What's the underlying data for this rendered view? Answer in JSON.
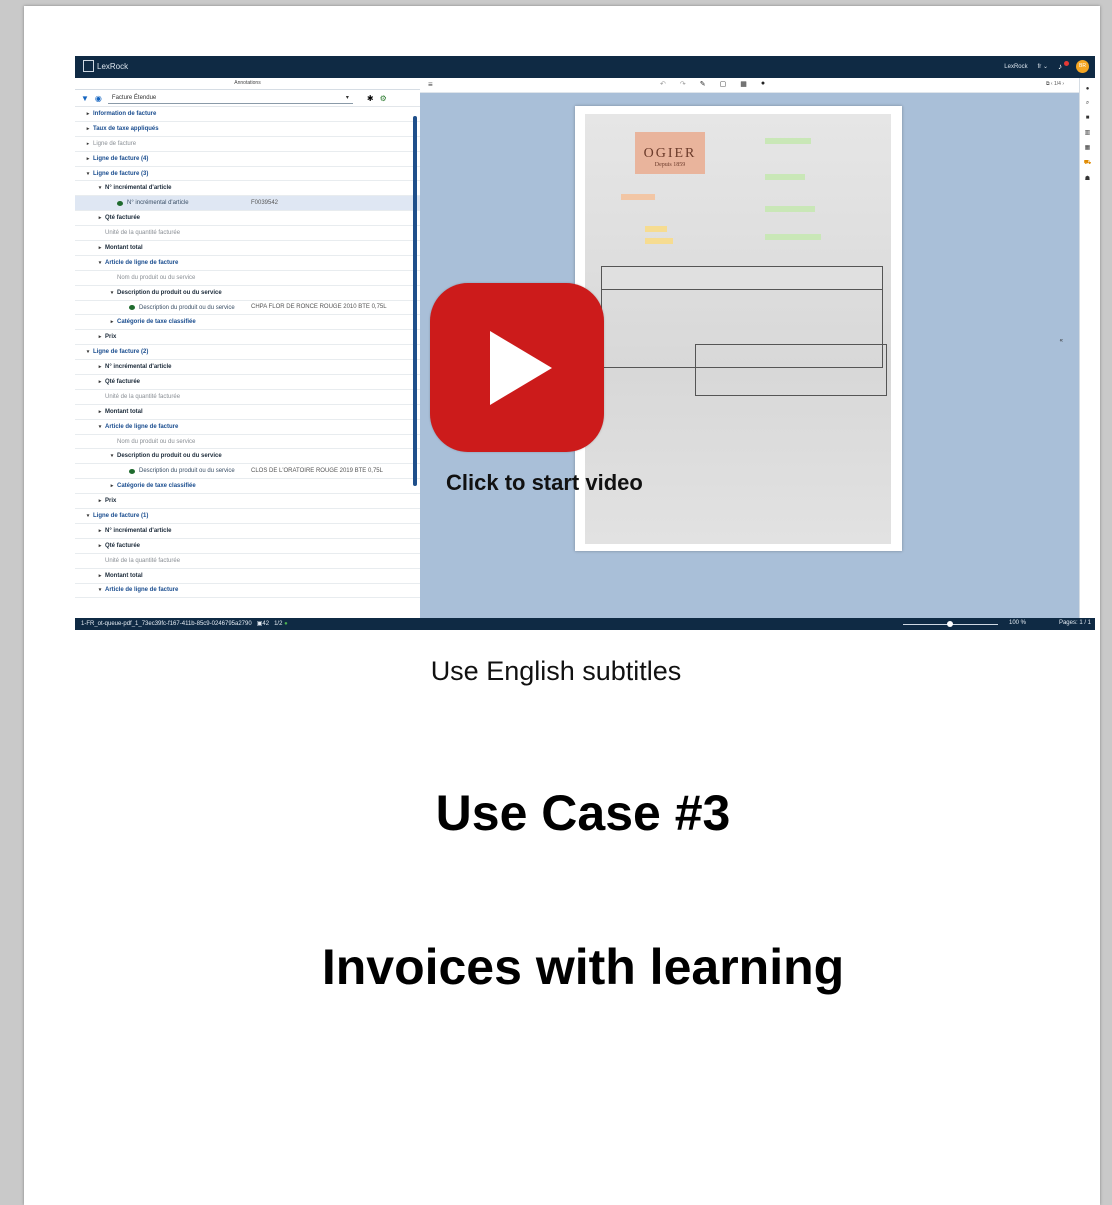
{
  "app": {
    "brand": "LexRock",
    "user_label": "LexRock",
    "lang": "fr",
    "avatar_initials": "BR",
    "accent": "#0f2a44",
    "play_color": "#cc1b1b"
  },
  "annotations": {
    "title": "Annotations",
    "filter_value": "Facture Étendue",
    "tree": [
      {
        "label": "Information de facture",
        "style": "blue",
        "indent": 0,
        "arrow": "▸"
      },
      {
        "label": "Taux de taxe appliqués",
        "style": "blue",
        "indent": 0,
        "arrow": "▸"
      },
      {
        "label": "Ligne de facture",
        "style": "grey",
        "indent": 0,
        "arrow": "▸"
      },
      {
        "label": "Ligne de facture (4)",
        "style": "blue",
        "indent": 0,
        "arrow": "▸"
      },
      {
        "label": "Ligne de facture (3)",
        "style": "blue",
        "indent": 0,
        "arrow": "▾"
      },
      {
        "label": "N° incrémental d'article",
        "style": "bold",
        "indent": 1,
        "arrow": "▾"
      },
      {
        "label": "N° incrémental d'article",
        "style": "leaf",
        "indent": 2,
        "arrow": "",
        "value": "F0039542",
        "highlight": true
      },
      {
        "label": "Qté facturée",
        "style": "bold",
        "indent": 1,
        "arrow": "▸"
      },
      {
        "label": "Unité de la quantité facturée",
        "style": "grey",
        "indent": 1,
        "arrow": ""
      },
      {
        "label": "Montant total",
        "style": "bold",
        "indent": 1,
        "arrow": "▸"
      },
      {
        "label": "Article de ligne de facture",
        "style": "blue",
        "indent": 1,
        "arrow": "▾"
      },
      {
        "label": "Nom du produit ou du service",
        "style": "grey",
        "indent": 2,
        "arrow": ""
      },
      {
        "label": "Description du produit ou du service",
        "style": "bold",
        "indent": 2,
        "arrow": "▾"
      },
      {
        "label": "Description du produit ou du service",
        "style": "leaf",
        "indent": 3,
        "arrow": "",
        "value": "CHPA FLOR DE RONCE ROUGE 2010 BTE 0,75L"
      },
      {
        "label": "Catégorie de taxe classifiée",
        "style": "blue",
        "indent": 2,
        "arrow": "▸"
      },
      {
        "label": "Prix",
        "style": "bold",
        "indent": 1,
        "arrow": "▸"
      },
      {
        "label": "Ligne de facture (2)",
        "style": "blue",
        "indent": 0,
        "arrow": "▾"
      },
      {
        "label": "N° incrémental d'article",
        "style": "bold",
        "indent": 1,
        "arrow": "▸"
      },
      {
        "label": "Qté facturée",
        "style": "bold",
        "indent": 1,
        "arrow": "▸"
      },
      {
        "label": "Unité de la quantité facturée",
        "style": "grey",
        "indent": 1,
        "arrow": ""
      },
      {
        "label": "Montant total",
        "style": "bold",
        "indent": 1,
        "arrow": "▸"
      },
      {
        "label": "Article de ligne de facture",
        "style": "blue",
        "indent": 1,
        "arrow": "▾"
      },
      {
        "label": "Nom du produit ou du service",
        "style": "grey",
        "indent": 2,
        "arrow": ""
      },
      {
        "label": "Description du produit ou du service",
        "style": "bold",
        "indent": 2,
        "arrow": "▾"
      },
      {
        "label": "Description du produit ou du service",
        "style": "leaf",
        "indent": 3,
        "arrow": "",
        "value": "CLOS DE L'ORATOIRE ROUGE 2019 BTE 0,75L"
      },
      {
        "label": "Catégorie de taxe classifiée",
        "style": "blue",
        "indent": 2,
        "arrow": "▸"
      },
      {
        "label": "Prix",
        "style": "bold",
        "indent": 1,
        "arrow": "▸"
      },
      {
        "label": "Ligne de facture (1)",
        "style": "blue",
        "indent": 0,
        "arrow": "▾"
      },
      {
        "label": "N° incrémental d'article",
        "style": "bold",
        "indent": 1,
        "arrow": "▸"
      },
      {
        "label": "Qté facturée",
        "style": "bold",
        "indent": 1,
        "arrow": "▸"
      },
      {
        "label": "Unité de la quantité facturée",
        "style": "grey",
        "indent": 1,
        "arrow": ""
      },
      {
        "label": "Montant total",
        "style": "bold",
        "indent": 1,
        "arrow": "▸"
      },
      {
        "label": "Article de ligne de facture",
        "style": "blue",
        "indent": 1,
        "arrow": "▾"
      }
    ]
  },
  "viewer": {
    "page_indicator": "1/4",
    "doc_brand": "OGIER",
    "doc_brand_sub": "Depuis 1859"
  },
  "status": {
    "file": "1-FR_ot-queue-pdf_1_73ec39fc-f167-411b-85c9-0246795a2790",
    "count": "42",
    "fraction": "1/2",
    "zoom": "100 %",
    "pages": "Pages: 1 / 1"
  },
  "video": {
    "cta": "Click to start video"
  },
  "captions": {
    "subtitle_note": "Use English subtitles",
    "heading1": "Use Case #3",
    "heading2": "Invoices with learning"
  }
}
